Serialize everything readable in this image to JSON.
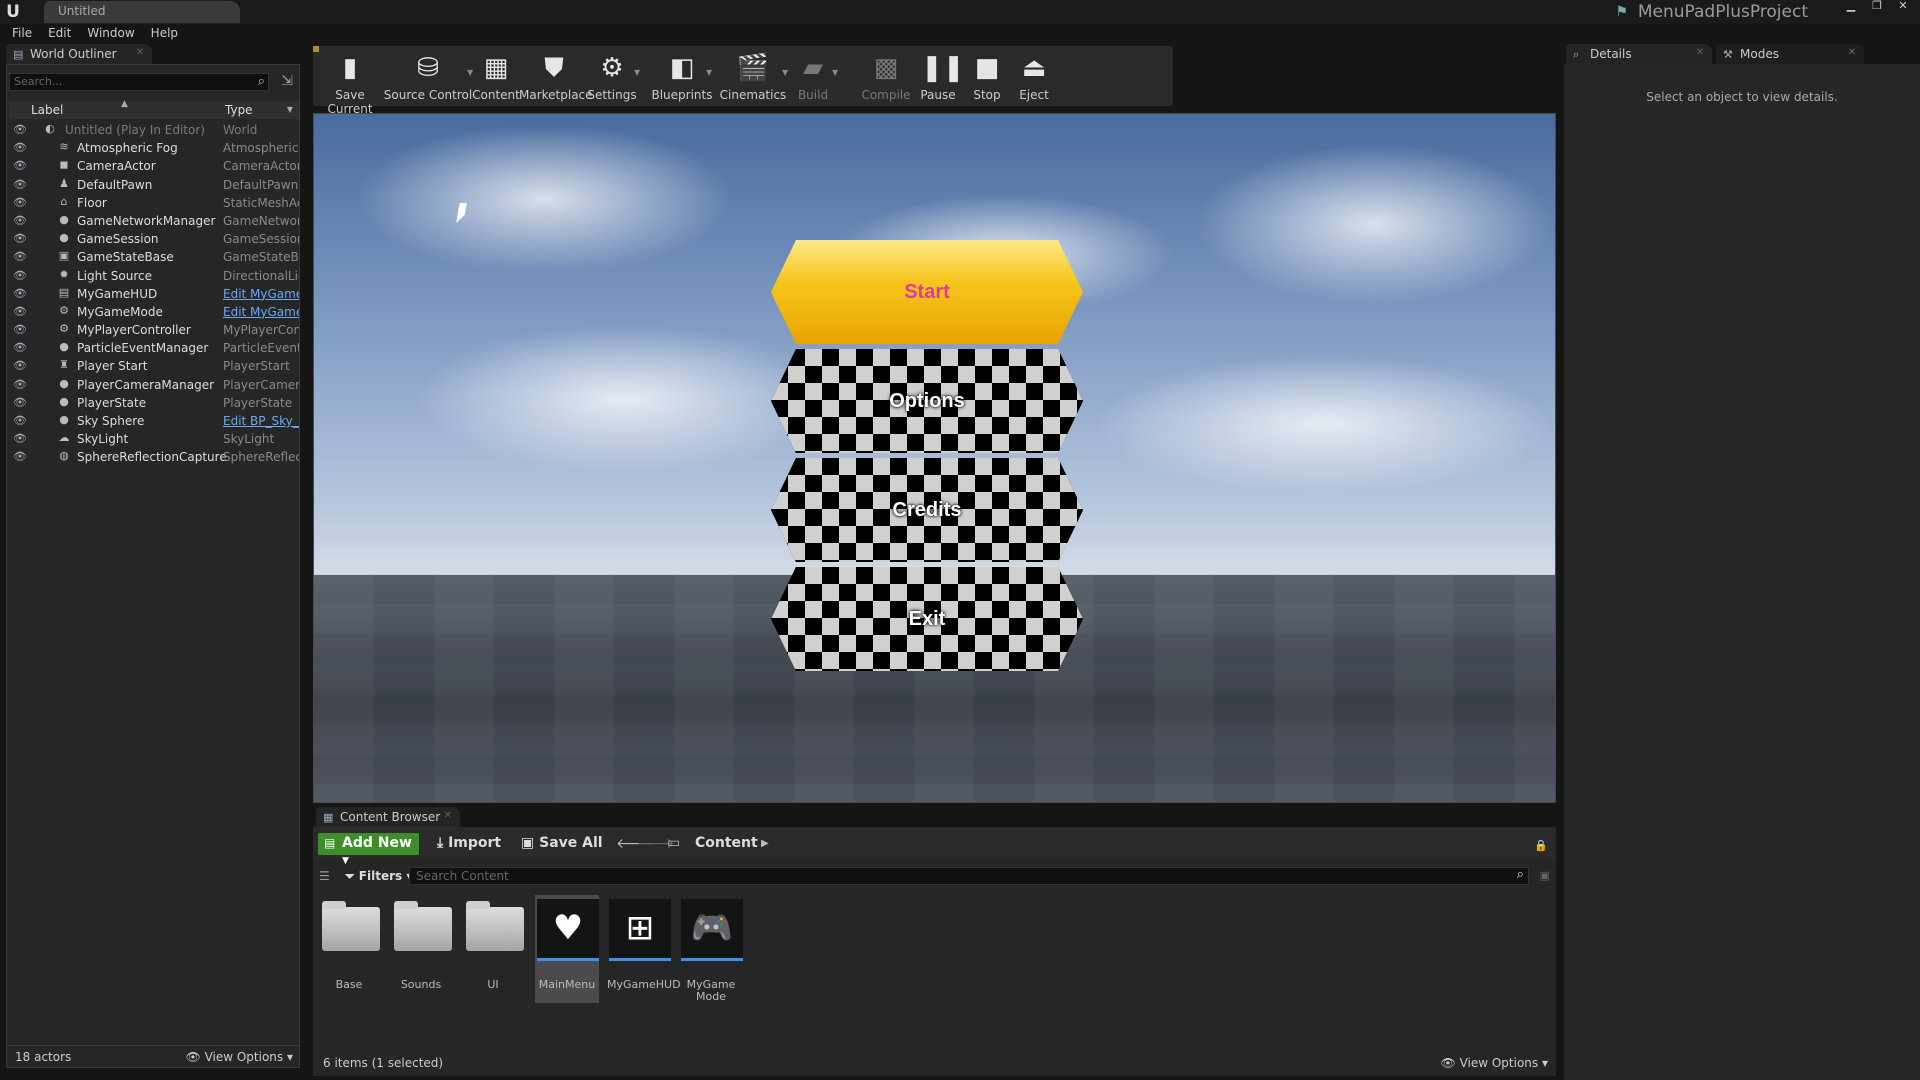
{
  "window": {
    "doc_tab": "Untitled",
    "project": "MenuPadPlusProject",
    "menu": [
      "File",
      "Edit",
      "Window",
      "Help"
    ]
  },
  "outliner": {
    "tab": "World Outliner",
    "search_placeholder": "Search...",
    "col_label": "Label",
    "col_type": "Type",
    "world": {
      "name": "Untitled (Play In Editor)",
      "type": "World"
    },
    "actors": [
      {
        "name": "Atmospheric Fog",
        "type": "AtmosphericFog",
        "icon": "fog-icon"
      },
      {
        "name": "CameraActor",
        "type": "CameraActor",
        "icon": "camera-icon"
      },
      {
        "name": "DefaultPawn",
        "type": "DefaultPawn",
        "icon": "pawn-icon"
      },
      {
        "name": "Floor",
        "type": "StaticMeshActor",
        "icon": "mesh-icon"
      },
      {
        "name": "GameNetworkManager",
        "type": "GameNetworkManager",
        "icon": "sphere-icon"
      },
      {
        "name": "GameSession",
        "type": "GameSession",
        "icon": "sphere-icon"
      },
      {
        "name": "GameStateBase",
        "type": "GameStateBase",
        "icon": "state-icon"
      },
      {
        "name": "Light Source",
        "type": "DirectionalLight",
        "icon": "light-icon"
      },
      {
        "name": "MyGameHUD",
        "type": "Edit MyGameHUD",
        "icon": "hud-icon",
        "link": true
      },
      {
        "name": "MyGameMode",
        "type": "Edit MyGameMode",
        "icon": "mode-icon",
        "link": true
      },
      {
        "name": "MyPlayerController",
        "type": "MyPlayerController",
        "icon": "controller-icon"
      },
      {
        "name": "ParticleEventManager",
        "type": "ParticleEventManager",
        "icon": "sphere-icon"
      },
      {
        "name": "Player Start",
        "type": "PlayerStart",
        "icon": "player-start-icon"
      },
      {
        "name": "PlayerCameraManager",
        "type": "PlayerCameraManager",
        "icon": "sphere-icon"
      },
      {
        "name": "PlayerState",
        "type": "PlayerState",
        "icon": "sphere-icon"
      },
      {
        "name": "Sky Sphere",
        "type": "Edit BP_Sky_Sphere",
        "icon": "sphere-icon",
        "link": true
      },
      {
        "name": "SkyLight",
        "type": "SkyLight",
        "icon": "skylight-icon"
      },
      {
        "name": "SphereReflectionCapture",
        "type": "SphereReflectionCapture",
        "icon": "reflection-icon"
      }
    ],
    "actor_count": "18 actors",
    "view_options": "View Options"
  },
  "toolbar": [
    {
      "label": "Save Current",
      "icon": "save-icon",
      "glyph": "▮"
    },
    {
      "label": "Source Control",
      "icon": "source-control-icon",
      "glyph": "⛁"
    },
    {
      "label": "Content",
      "icon": "content-icon",
      "glyph": "▦"
    },
    {
      "label": "Marketplace",
      "icon": "marketplace-icon",
      "glyph": "⛊"
    },
    {
      "label": "Settings",
      "icon": "settings-icon",
      "glyph": "⚙"
    },
    {
      "label": "Blueprints",
      "icon": "blueprints-icon",
      "glyph": "◧"
    },
    {
      "label": "Cinematics",
      "icon": "cinematics-icon",
      "glyph": "🎬"
    },
    {
      "label": "Build",
      "icon": "build-icon",
      "glyph": "▰"
    },
    {
      "label": "Compile",
      "icon": "compile-icon",
      "glyph": "▩"
    },
    {
      "label": "Pause",
      "icon": "pause-icon",
      "glyph": "❚❚"
    },
    {
      "label": "Stop",
      "icon": "stop-icon",
      "glyph": "■"
    },
    {
      "label": "Eject",
      "icon": "eject-icon",
      "glyph": "⏏"
    }
  ],
  "menu_buttons": {
    "start": "Start",
    "options": "Options",
    "credits": "Credits",
    "exit": "Exit"
  },
  "details": {
    "tab": "Details",
    "modes_tab": "Modes",
    "message": "Select an object to view details."
  },
  "content_browser": {
    "tab": "Content Browser",
    "add_new": "Add New",
    "import": "Import",
    "save_all": "Save All",
    "path": "Content",
    "filters": "Filters",
    "search_placeholder": "Search Content",
    "assets": [
      {
        "name": "Base",
        "kind": "folder"
      },
      {
        "name": "Sounds",
        "kind": "folder"
      },
      {
        "name": "UI",
        "kind": "folder"
      },
      {
        "name": "MainMenu",
        "kind": "widget",
        "selected": true,
        "icon": "widget-blueprint-icon"
      },
      {
        "name": "MyGameHUD",
        "kind": "hud",
        "icon": "hud-blueprint-icon"
      },
      {
        "name": "MyGame Mode",
        "kind": "mode",
        "icon": "gamemode-blueprint-icon"
      }
    ],
    "status": "6 items (1 selected)",
    "view_options": "View Options"
  },
  "colors": {
    "accent_green": "#3e8d2b",
    "link_blue": "#6aa8f0",
    "start_text": "#e23aa0"
  }
}
